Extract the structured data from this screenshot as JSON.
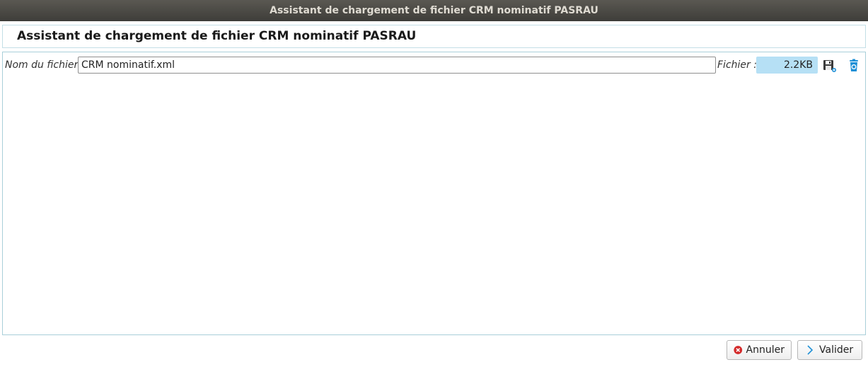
{
  "window": {
    "title": "Assistant de chargement de fichier CRM nominatif PASRAU"
  },
  "header": {
    "title": "Assistant de chargement de fichier CRM nominatif PASRAU"
  },
  "form": {
    "filename_label": "Nom du fichier :",
    "filename_value": "CRM nominatif.xml",
    "file_label": "Fichier :",
    "file_size": "2.2KB"
  },
  "icons": {
    "save": "save-icon",
    "delete": "trash-icon",
    "cancel": "cancel-icon",
    "validate": "chevron-right-icon"
  },
  "buttons": {
    "cancel_label": "Annuler",
    "validate_label": "Valider"
  },
  "colors": {
    "accent": "#1e8fd6",
    "cancel_red": "#d42a2a",
    "file_size_bg": "#b6e0f5"
  }
}
